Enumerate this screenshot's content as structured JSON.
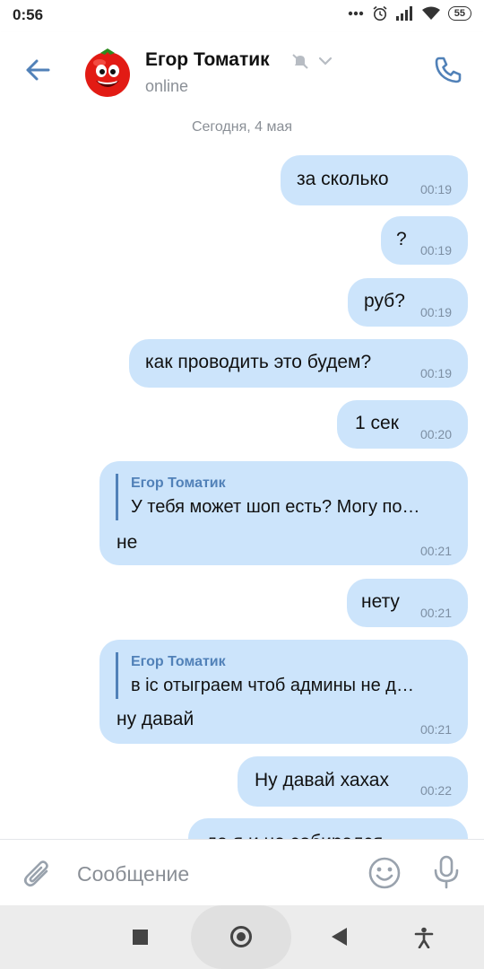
{
  "status_bar": {
    "time": "0:56",
    "battery": "55"
  },
  "header": {
    "name": "Егор Томатик",
    "status": "online"
  },
  "chat": {
    "date_separator": "Сегодня, 4 мая",
    "messages": [
      {
        "text": "за сколько",
        "time": "00:19"
      },
      {
        "text": "?",
        "time": "00:19"
      },
      {
        "text": "руб?",
        "time": "00:19"
      },
      {
        "text": "как проводить это будем?",
        "time": "00:19"
      },
      {
        "text": "1 сек",
        "time": "00:20"
      },
      {
        "reply_name": "Егор Томатик",
        "reply_text": "У тебя может шоп есть? Могу по…",
        "text": "не",
        "time": "00:21"
      },
      {
        "text": "нету",
        "time": "00:21"
      },
      {
        "reply_name": "Егор Томатик",
        "reply_text": "в ic отыграем чтоб админы не д…",
        "text": "ну давай",
        "time": "00:21"
      },
      {
        "text": "Ну давай хахах",
        "time": "00:22"
      },
      {
        "text": "да я и не собирался",
        "time": ""
      }
    ]
  },
  "composer": {
    "placeholder": "Сообщение"
  },
  "colors": {
    "accent": "#5181b8",
    "bubble": "#cce4fb"
  }
}
